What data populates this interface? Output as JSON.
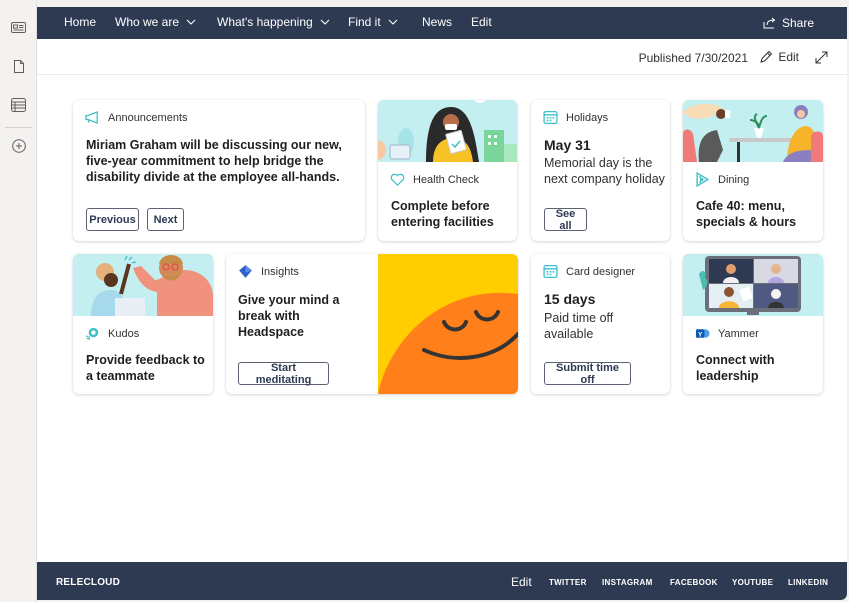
{
  "rail": {
    "icons": [
      "news-icon",
      "page-icon",
      "list-icon",
      "add-icon"
    ]
  },
  "topnav": {
    "items": [
      {
        "label": "Home",
        "dropdown": false
      },
      {
        "label": "Who we are",
        "dropdown": true
      },
      {
        "label": "What's happening",
        "dropdown": true
      },
      {
        "label": "Find it",
        "dropdown": true
      },
      {
        "label": "News",
        "dropdown": false
      },
      {
        "label": "Edit",
        "dropdown": false
      }
    ],
    "share_label": "Share"
  },
  "commandbar": {
    "published": "Published 7/30/2021",
    "edit_label": "Edit"
  },
  "cards": {
    "announcements": {
      "category": "Announcements",
      "title": "Miriam Graham will be discussing our new, five-year commitment to help bridge the disability divide at the employee all-hands.",
      "prev_label": "Previous",
      "next_label": "Next"
    },
    "health": {
      "category": "Health Check",
      "title": "Complete before entering facilities"
    },
    "holidays": {
      "category": "Holidays",
      "date": "May 31",
      "description": "Memorial day is the next company holiday",
      "button_label": "See all"
    },
    "dining": {
      "category": "Dining",
      "title": "Cafe 40: menu, specials & hours"
    },
    "kudos": {
      "category": "Kudos",
      "title": "Provide feedback to a teammate"
    },
    "insights": {
      "category": "Insights",
      "title": "Give your mind a break with Headspace",
      "button_label": "Start meditating"
    },
    "card_designer": {
      "category": "Card designer",
      "amount": "15 days",
      "description": "Paid time off available",
      "button_label": "Submit time off"
    },
    "yammer": {
      "category": "Yammer",
      "title": "Connect with leadership"
    }
  },
  "footer": {
    "brand": "RELECLOUD",
    "edit_label": "Edit",
    "links": [
      "TWITTER",
      "INSTAGRAM",
      "FACEBOOK",
      "YOUTUBE",
      "LINKEDIN"
    ]
  },
  "colors": {
    "nav_bg": "#2e3a52",
    "accent_teal": "#3bbfc8",
    "illustration_bg": "#bdeff0"
  }
}
